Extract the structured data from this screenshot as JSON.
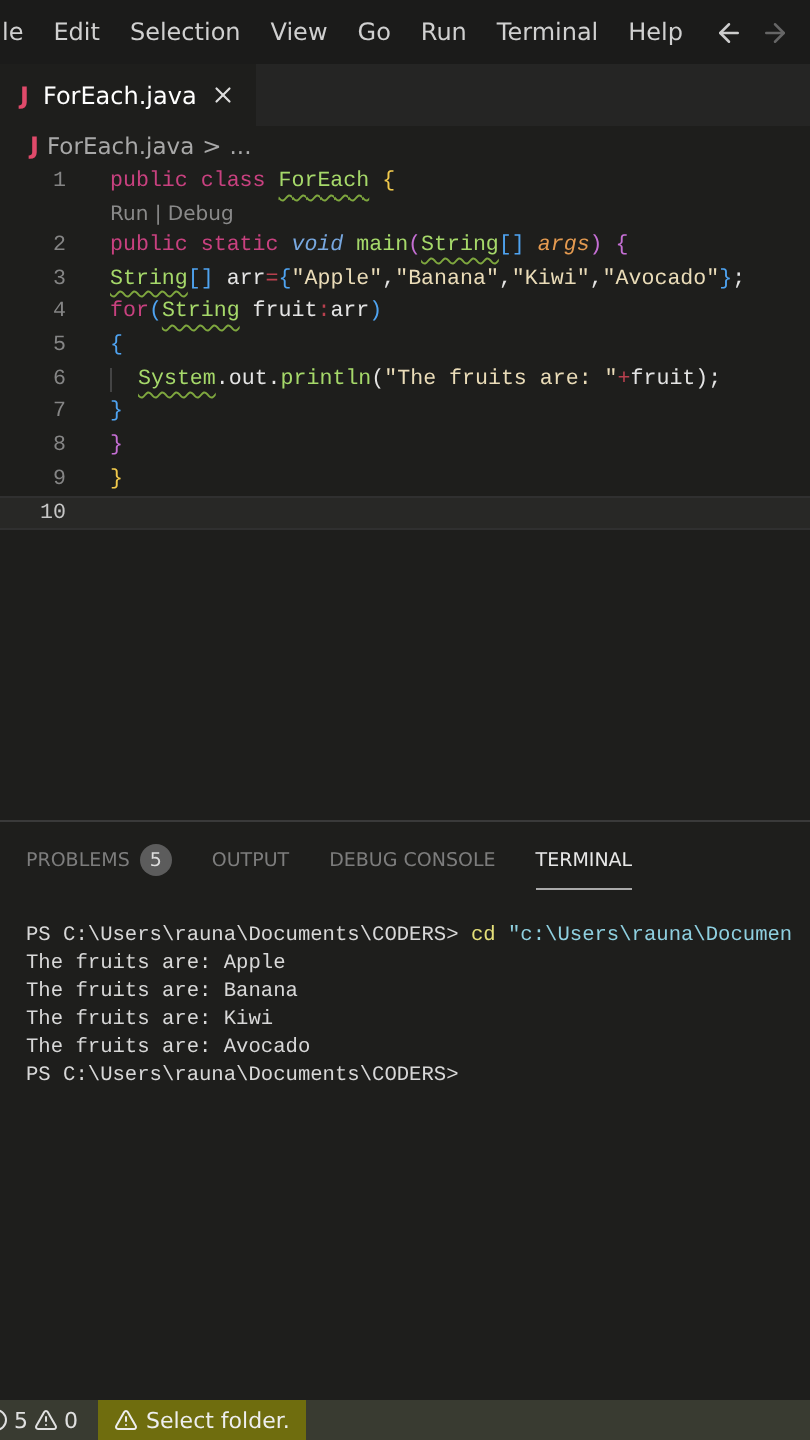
{
  "menu_bar": {
    "items": [
      "le",
      "Edit",
      "Selection",
      "View",
      "Go",
      "Run",
      "Terminal",
      "Help"
    ]
  },
  "tabs": [
    {
      "icon": "J",
      "label": "ForEach.java",
      "selected": true
    }
  ],
  "breadcrumb": {
    "icon": "J",
    "file": "ForEach.java",
    "separator": ">",
    "rest": "..."
  },
  "editor": {
    "lines": [
      {
        "number": "1",
        "current": false,
        "tokens": [
          {
            "t": "public ",
            "kind": "kw"
          },
          {
            "t": "class ",
            "kind": "kw"
          },
          {
            "t": "ForEach",
            "kind": "cls"
          },
          {
            "t": " {",
            "kind": "b1"
          }
        ]
      },
      {
        "number": "2",
        "current": false,
        "codelens": "Run | Debug",
        "tokens": [
          {
            "t": "public ",
            "kind": "kw"
          },
          {
            "t": "static ",
            "kind": "kw"
          },
          {
            "t": "void ",
            "kind": "type"
          },
          {
            "t": "main",
            "kind": "fn"
          },
          {
            "t": "(",
            "kind": "b2"
          },
          {
            "t": "String",
            "kind": "cls"
          },
          {
            "t": "[] ",
            "kind": "b3"
          },
          {
            "t": "args",
            "kind": "param"
          },
          {
            "t": ") {",
            "kind": "b2"
          }
        ]
      },
      {
        "number": "3",
        "current": false,
        "tokens": [
          {
            "t": "String",
            "kind": "cls"
          },
          {
            "t": "[]",
            "kind": "b3"
          },
          {
            "t": " arr",
            "kind": "plain"
          },
          {
            "t": "=",
            "kind": "op"
          },
          {
            "t": "{",
            "kind": "b3"
          },
          {
            "t": "\"Apple\"",
            "kind": "str"
          },
          {
            "t": ",",
            "kind": "plain"
          },
          {
            "t": "\"Banana\"",
            "kind": "str"
          },
          {
            "t": ",",
            "kind": "plain"
          },
          {
            "t": "\"Kiwi\"",
            "kind": "str"
          },
          {
            "t": ",",
            "kind": "plain"
          },
          {
            "t": "\"Avocado\"",
            "kind": "str"
          },
          {
            "t": "}",
            "kind": "b3"
          },
          {
            "t": ";",
            "kind": "plain"
          }
        ]
      },
      {
        "number": "4",
        "current": false,
        "tokens": [
          {
            "t": "for",
            "kind": "kw"
          },
          {
            "t": "(",
            "kind": "b3"
          },
          {
            "t": "String",
            "kind": "cls"
          },
          {
            "t": " fruit",
            "kind": "plain"
          },
          {
            "t": ":",
            "kind": "op"
          },
          {
            "t": "arr",
            "kind": "plain"
          },
          {
            "t": ")",
            "kind": "b3"
          }
        ]
      },
      {
        "number": "5",
        "current": false,
        "tokens": [
          {
            "t": "{",
            "kind": "b3"
          }
        ]
      },
      {
        "number": "6",
        "current": false,
        "nested": true,
        "tokens": [
          {
            "t": "System",
            "kind": "cls"
          },
          {
            "t": ".out.",
            "kind": "plain"
          },
          {
            "t": "println",
            "kind": "fn"
          },
          {
            "t": "(",
            "kind": "plain"
          },
          {
            "t": "\"The fruits are: \"",
            "kind": "str"
          },
          {
            "t": "+",
            "kind": "op"
          },
          {
            "t": "fruit",
            "kind": "plain"
          },
          {
            "t": ");",
            "kind": "plain"
          }
        ]
      },
      {
        "number": "7",
        "current": false,
        "tokens": [
          {
            "t": "}",
            "kind": "b3"
          }
        ]
      },
      {
        "number": "8",
        "current": false,
        "tokens": [
          {
            "t": "}",
            "kind": "b2"
          }
        ]
      },
      {
        "number": "9",
        "current": false,
        "tokens": [
          {
            "t": "}",
            "kind": "b1"
          }
        ]
      },
      {
        "number": "10",
        "current": true
      }
    ]
  },
  "panel": {
    "tabs": [
      {
        "label": "PROBLEMS",
        "badge": "5",
        "selected": false
      },
      {
        "label": "OUTPUT",
        "selected": false
      },
      {
        "label": "DEBUG CONSOLE",
        "selected": false
      },
      {
        "label": "TERMINAL",
        "selected": true
      }
    ],
    "terminal": {
      "lines": [
        [
          {
            "t": "PS C:\\Users\\rauna\\Documents\\CODERS> ",
            "kind": "plain"
          },
          {
            "t": "cd",
            "kind": "cmd"
          },
          {
            "t": " \"c:\\Users\\rauna\\Documen",
            "kind": "arg"
          }
        ],
        [
          {
            "t": "The fruits are: Apple",
            "kind": "plain"
          }
        ],
        [
          {
            "t": "The fruits are: Banana",
            "kind": "plain"
          }
        ],
        [
          {
            "t": "The fruits are: Kiwi",
            "kind": "plain"
          }
        ],
        [
          {
            "t": "The fruits are: Avocado",
            "kind": "plain"
          }
        ],
        [
          {
            "t": "PS C:\\Users\\rauna\\Documents\\CODERS>",
            "kind": "plain"
          }
        ]
      ]
    }
  },
  "status_bar": {
    "errors": "5",
    "warnings": "0",
    "notice": "Select folder."
  }
}
